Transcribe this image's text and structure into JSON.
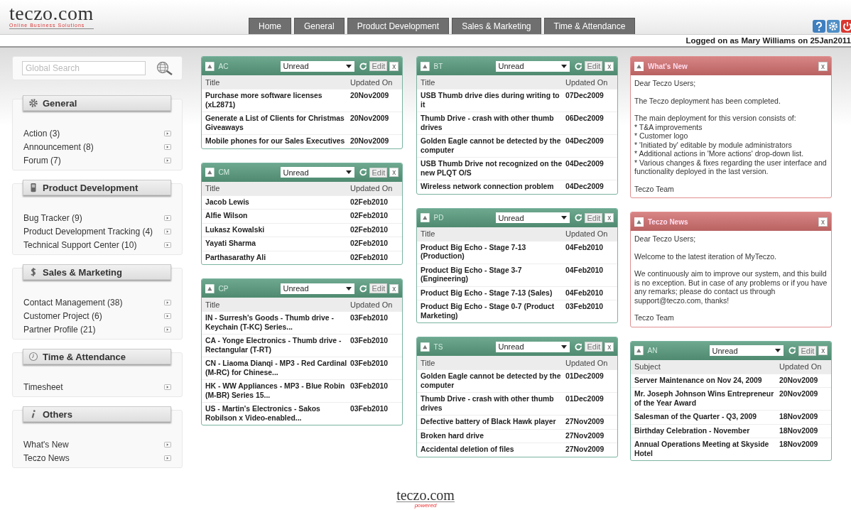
{
  "logo": {
    "name": "teczo.com",
    "tagline": "Online Business Solutions"
  },
  "nav": [
    {
      "label": "Home",
      "selected": false
    },
    {
      "label": "General",
      "selected": false
    },
    {
      "label": "Product Development",
      "selected": false
    },
    {
      "label": "Sales & Marketing",
      "selected": false
    },
    {
      "label": "Time & Attendance",
      "selected": false
    }
  ],
  "user_status": "Logged on as Mary Williams on 25Jan2011",
  "search": {
    "placeholder": "Global Search"
  },
  "sidebar": [
    {
      "title": "General",
      "kind": "gear",
      "items": [
        "Action (3)",
        "Announcement (8)",
        "Forum (7)"
      ]
    },
    {
      "title": "Product Development",
      "kind": "phone",
      "items": [
        "Bug Tracker (9)",
        "Product Development Tracking (4)",
        "Technical Support Center (10)"
      ]
    },
    {
      "title": "Sales & Marketing",
      "kind": "dollar",
      "items": [
        "Contact Management (38)",
        "Customer Project (6)",
        "Partner Profile (21)"
      ]
    },
    {
      "title": "Time & Attendance",
      "kind": "clock",
      "items": [
        "Timesheet"
      ]
    },
    {
      "title": "Others",
      "kind": "info",
      "items": [
        "What's New",
        "Teczo News"
      ]
    }
  ],
  "columns": [
    [
      {
        "kind": "list",
        "title": "AC",
        "filter": "Unread",
        "edit": "Edit",
        "close": "x",
        "headers": [
          "Title",
          "Updated On"
        ],
        "rows": [
          [
            "Purchase more software licenses (xL2871)",
            "20Nov2009"
          ],
          [
            "Generate a List of Clients for Christmas Giveaways",
            "20Nov2009"
          ],
          [
            "Mobile phones for our Sales Executives",
            "20Nov2009"
          ]
        ]
      },
      {
        "kind": "list",
        "title": "CM",
        "filter": "Unread",
        "edit": "Edit",
        "close": "x",
        "headers": [
          "Title",
          "Updated On"
        ],
        "rows": [
          [
            "Jacob Lewis",
            "02Feb2010"
          ],
          [
            "Alfie Wilson",
            "02Feb2010"
          ],
          [
            "Lukasz Kowalski",
            "02Feb2010"
          ],
          [
            "Yayati Sharma",
            "02Feb2010"
          ],
          [
            "Parthasarathy Ali",
            "02Feb2010"
          ]
        ]
      },
      {
        "kind": "list",
        "title": "CP",
        "filter": "Unread",
        "edit": "Edit",
        "close": "x",
        "headers": [
          "Title",
          "Updated On"
        ],
        "rows": [
          [
            "IN - Surresh's Goods - Thumb drive - Keychain (T-KC) Series...",
            "03Feb2010"
          ],
          [
            "CA - Yonge Electronics - Thumb drive - Rectangular (T-RT)",
            "03Feb2010"
          ],
          [
            "CN - Liaoma Dianqi - MP3 - Red Cardinal (M-RC) for Chinese...",
            "03Feb2010"
          ],
          [
            "HK - WW Appliances - MP3 - Blue Robin (M-BR) Series 15...",
            "03Feb2010"
          ],
          [
            "US - Martin's Electronics - Sakos Robilson x Video-enabled...",
            "03Feb2010"
          ]
        ]
      }
    ],
    [
      {
        "kind": "list",
        "title": "BT",
        "filter": "Unread",
        "edit": "Edit",
        "close": "x",
        "headers": [
          "Title",
          "Updated On"
        ],
        "rows": [
          [
            "USB Thumb drive dies during writing to it",
            "07Dec2009"
          ],
          [
            "Thumb Drive - crash with other thumb drives",
            "06Dec2009"
          ],
          [
            "Golden Eagle cannot be detected by the computer",
            "04Dec2009"
          ],
          [
            "USB Thumb Drive not recognized on the new PLQT O/S",
            "04Dec2009"
          ],
          [
            "Wireless network connection problem",
            "04Dec2009"
          ]
        ]
      },
      {
        "kind": "list",
        "title": "PD",
        "filter": "Unread",
        "edit": "Edit",
        "close": "x",
        "headers": [
          "Title",
          "Updated On"
        ],
        "rows": [
          [
            "Product Big Echo - Stage 7-13 (Production)",
            "04Feb2010"
          ],
          [
            "Product Big Echo - Stage 3-7 (Engineering)",
            "04Feb2010"
          ],
          [
            "Product Big Echo - Stage 7-13 (Sales)",
            "04Feb2010"
          ],
          [
            "Product Big Echo - Stage 0-7 (Product Marketing)",
            "03Feb2010"
          ]
        ]
      },
      {
        "kind": "list",
        "title": "TS",
        "filter": "Unread",
        "edit": "Edit",
        "close": "x",
        "headers": [
          "Title",
          "Updated On"
        ],
        "rows": [
          [
            "Golden Eagle cannot be detected by the computer",
            "01Dec2009"
          ],
          [
            "Thumb Drive - crash with other thumb drives",
            "01Dec2009"
          ],
          [
            "Defective battery of Black Hawk player",
            "27Nov2009"
          ],
          [
            "Broken hard drive",
            "27Nov2009"
          ],
          [
            "Accidental deletion of files",
            "27Nov2009"
          ]
        ]
      }
    ],
    [
      {
        "kind": "text",
        "title": "What's New",
        "close": "x",
        "paragraphs": [
          "Dear Teczo Users;",
          "The Teczo deployment has been completed.",
          "The main deployment for this version consists of:\n* T&A improvements\n* Customer logo\n* 'Initiated by' editable by module administrators\n* Additional actions in 'More actions' drop-down list.\n* Various changes & fixes regarding the user interface and functionality deployed in the last version.",
          "Teczo Team"
        ]
      },
      {
        "kind": "text",
        "title": "Teczo News",
        "close": "x",
        "paragraphs": [
          "Dear Teczo Users;",
          "Welcome to the latest iteration of MyTeczo.",
          "We continuously aim to improve our system, and this build is no exception. But in case of any problems or if you have any remarks; please do contact us through support@teczo.com, thanks!",
          "Teczo Team"
        ]
      },
      {
        "kind": "list",
        "title": "AN",
        "filter": "Unread",
        "edit": "Edit",
        "close": "x",
        "headers": [
          "Subject",
          "Updated On"
        ],
        "rows": [
          [
            "Server Maintenance on Nov 24, 2009",
            "20Nov2009"
          ],
          [
            "Mr. Joseph Johnson Wins Entrepreneur of the Year Award",
            "20Nov2009"
          ],
          [
            "Salesman of the Quarter - Q3, 2009",
            "18Nov2009"
          ],
          [
            "Birthday Celebration - November",
            "18Nov2009"
          ],
          [
            "Annual Operations Meeting at Skyside Hotel",
            "18Nov2009"
          ]
        ]
      }
    ]
  ],
  "footer": {
    "logo": "teczo.com",
    "tagline": "powered"
  }
}
